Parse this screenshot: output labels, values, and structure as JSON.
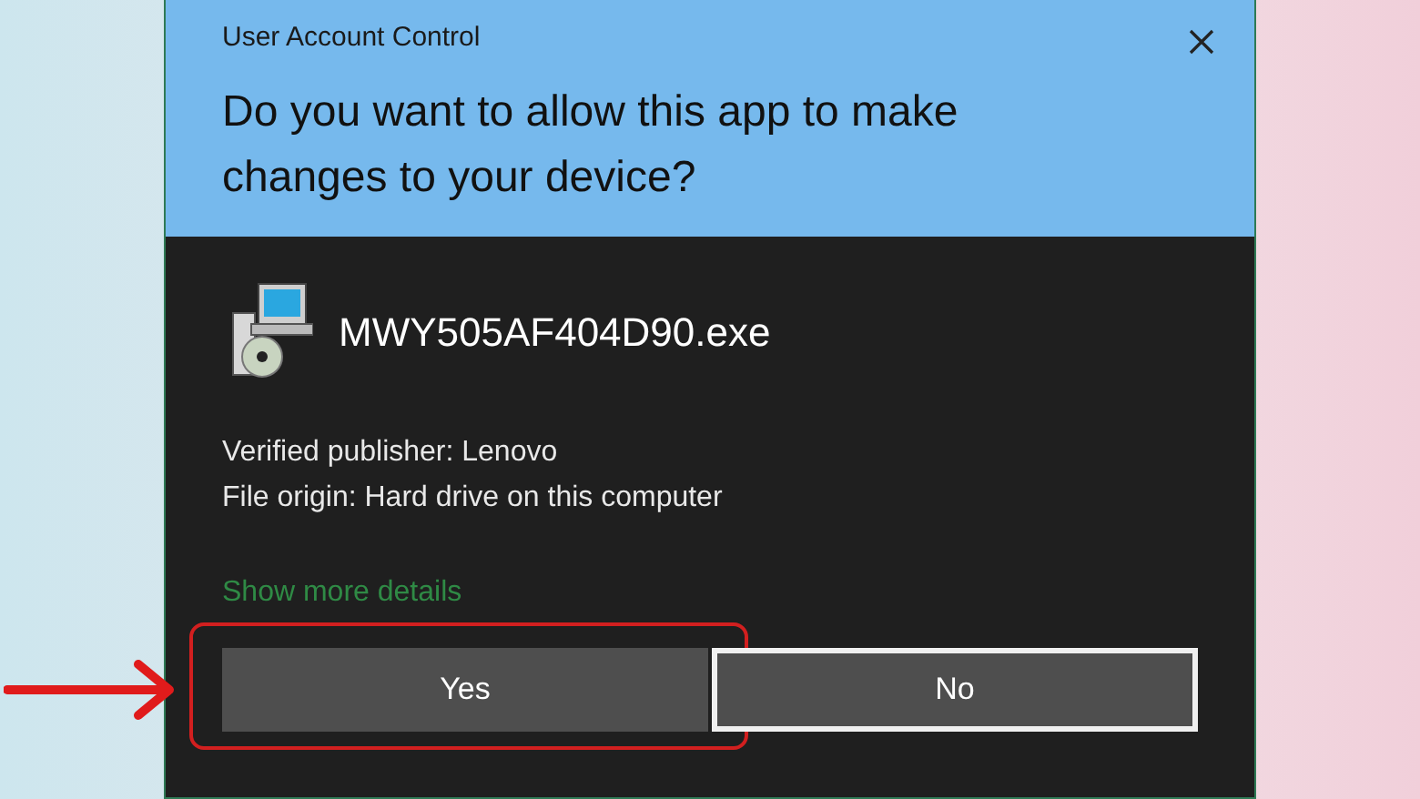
{
  "dialog": {
    "title": "User Account Control",
    "question": "Do you want to allow this app to make changes to your device?",
    "app_name": "MWY505AF404D90.exe",
    "details": [
      "Verified publisher: Lenovo",
      "File origin: Hard drive on this computer"
    ],
    "details_link": "Show more details",
    "buttons": [
      {
        "label": "Yes",
        "focused": false,
        "highlighted": true
      },
      {
        "label": "No",
        "focused": true,
        "highlighted": false
      }
    ]
  }
}
